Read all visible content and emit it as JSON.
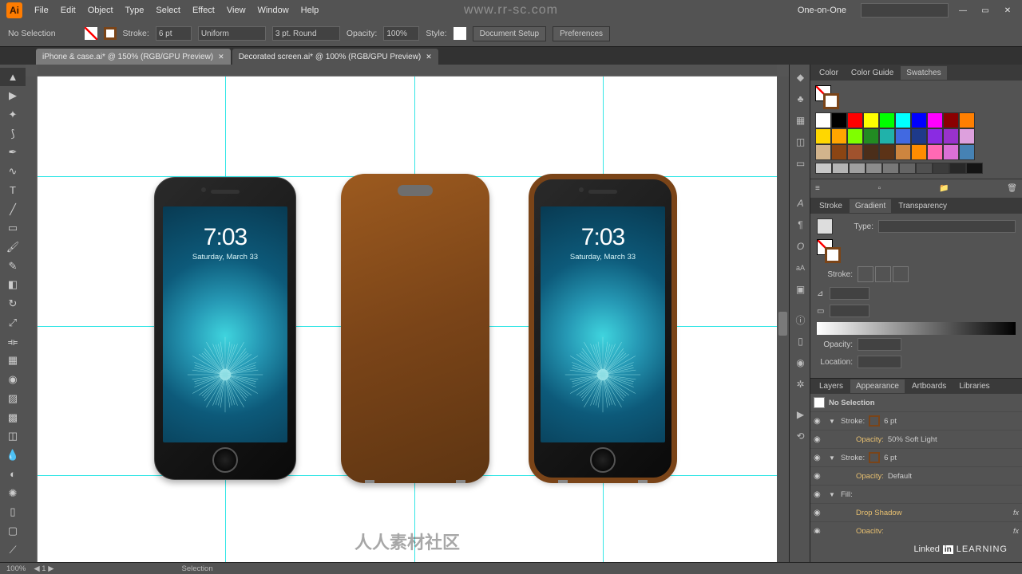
{
  "menu": {
    "items": [
      "File",
      "Edit",
      "Object",
      "Type",
      "Select",
      "Effect",
      "View",
      "Window",
      "Help"
    ],
    "workspace": "One-on-One"
  },
  "control": {
    "selection": "No Selection",
    "strokeLbl": "Stroke:",
    "strokeVal": "6 pt",
    "uniform": "Uniform",
    "round": "3 pt. Round",
    "opacityLbl": "Opacity:",
    "opacityVal": "100%",
    "styleLbl": "Style:",
    "docSetup": "Document Setup",
    "prefs": "Preferences"
  },
  "tabs": {
    "t1": "iPhone & case.ai* @ 150% (RGB/GPU Preview)",
    "t2": "Decorated screen.ai* @ 100% (RGB/GPU Preview)"
  },
  "phone": {
    "time": "7:03",
    "date": "Saturday, March 33"
  },
  "panels": {
    "row1": [
      "Color",
      "Color Guide",
      "Swatches"
    ],
    "row2": [
      "Stroke",
      "Gradient",
      "Transparency"
    ],
    "row3": [
      "Layers",
      "Appearance",
      "Artboards",
      "Libraries"
    ],
    "grad": {
      "typeLbl": "Type:",
      "strokeLbl": "Stroke:",
      "opacityLbl": "Opacity:",
      "locationLbl": "Location:"
    },
    "appearance": {
      "header": "No Selection",
      "rows": [
        {
          "label": "Stroke:",
          "val": "6 pt",
          "sub": false
        },
        {
          "label": "Opacity:",
          "val": "50% Soft Light",
          "sub": true
        },
        {
          "label": "Stroke:",
          "val": "6 pt",
          "sub": false
        },
        {
          "label": "Opacity:",
          "val": "Default",
          "sub": true
        },
        {
          "label": "Fill:",
          "val": "",
          "sub": false
        },
        {
          "label": "Drop Shadow",
          "val": "",
          "sub": true,
          "fx": true
        },
        {
          "label": "Opacity:",
          "val": "",
          "sub": true,
          "fx": true
        }
      ]
    }
  },
  "status": {
    "zoom": "100%",
    "art": "1",
    "tool": "Selection"
  },
  "swatches": {
    "r1": [
      "#ffffff",
      "#000000",
      "#ff0000",
      "#ffff00",
      "#00ff00",
      "#00ffff",
      "#0000ff",
      "#ff00ff",
      "#8b0000",
      "#ff7f00"
    ],
    "r2": [
      "#ffd700",
      "#ffa500",
      "#7fff00",
      "#228b22",
      "#20b2aa",
      "#4169e1",
      "#1e3a8a",
      "#8a2be2",
      "#9932cc",
      "#dda0dd"
    ],
    "r3": [
      "#d2b48c",
      "#8b4513",
      "#a0522d",
      "#4b2e1a",
      "#5c3317",
      "#cd853f",
      "#ff8c00",
      "#ff69b4",
      "#da70d6",
      "#4682b4"
    ],
    "grays": [
      "#c8c8c8",
      "#b4b4b4",
      "#a0a0a0",
      "#8c8c8c",
      "#787878",
      "#646464",
      "#505050",
      "#3c3c3c",
      "#282828",
      "#141414"
    ]
  },
  "wm": {
    "url": "www.rr-sc.com",
    "cn": "人人素材社区",
    "brand": "Linked",
    "brand2": "LEARNING"
  }
}
